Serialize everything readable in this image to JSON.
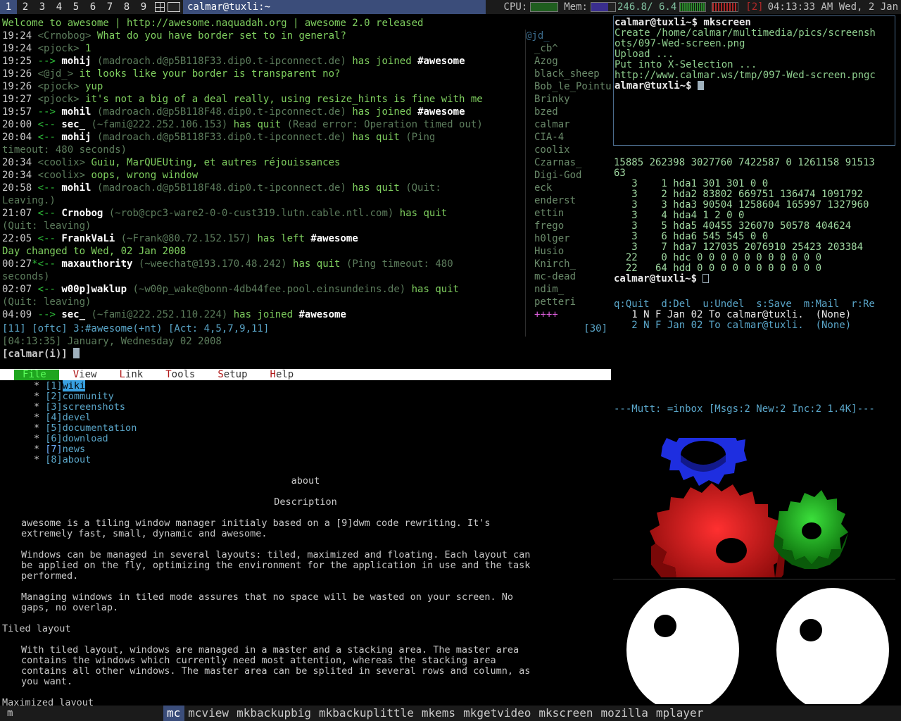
{
  "topbar": {
    "tags": [
      "1",
      "2",
      "3",
      "4",
      "5",
      "6",
      "7",
      "8",
      "9"
    ],
    "selected_tag": "1",
    "window_title": "calmar@tuxli:~",
    "cpu_label": "CPU:",
    "mem_label": "Mem:",
    "mem_value": "246.8/ 6.4",
    "clients": "[2]",
    "datetime": "04:13:33 AM Wed,  2 Jan"
  },
  "weechat": {
    "lines": [
      {
        "time": "Welcome to awesome | http://awesome.naquadah.org | awesome 2.0 released",
        "parts": []
      },
      {
        "time": "19:24",
        "parts": [
          {
            "c": "dim",
            "t": " <"
          },
          {
            "c": "dim",
            "t": "Crnobog"
          },
          {
            "c": "dim",
            "t": "> "
          },
          {
            "c": "lgreen",
            "t": "What do you have border set to in general?"
          }
        ]
      },
      {
        "time": "19:24",
        "parts": [
          {
            "c": "dim",
            "t": " <pjock> "
          },
          {
            "c": "lgreen",
            "t": "1"
          }
        ]
      },
      {
        "time": "19:25",
        "parts": [
          {
            "c": "green",
            "t": " --> "
          },
          {
            "c": "bold",
            "t": "mohij"
          },
          {
            "c": "dim",
            "t": " (madroach.d@p5B118F33.dip0.t-ipconnect.de) "
          },
          {
            "c": "lgreen",
            "t": "has joined "
          },
          {
            "c": "bold",
            "t": "#awesome"
          }
        ]
      },
      {
        "time": "19:26",
        "parts": [
          {
            "c": "dim",
            "t": " <@jd_> "
          },
          {
            "c": "lgreen",
            "t": "it looks like your border is transparent no?"
          }
        ]
      },
      {
        "time": "19:26",
        "parts": [
          {
            "c": "dim",
            "t": " <pjock> "
          },
          {
            "c": "lgreen",
            "t": "yup"
          }
        ]
      },
      {
        "time": "19:27",
        "parts": [
          {
            "c": "dim",
            "t": " <pjock> "
          },
          {
            "c": "lgreen",
            "t": "it's not a big of a deal really, using resize_hints is fine with me"
          }
        ]
      },
      {
        "time": "19:57",
        "parts": [
          {
            "c": "green",
            "t": " --> "
          },
          {
            "c": "bold",
            "t": "mohil"
          },
          {
            "c": "dim",
            "t": " (madroach.d@p5B118F48.dip0.t-ipconnect.de) "
          },
          {
            "c": "lgreen",
            "t": "has joined "
          },
          {
            "c": "bold",
            "t": "#awesome"
          }
        ]
      },
      {
        "time": "20:00",
        "parts": [
          {
            "c": "green",
            "t": " <-- "
          },
          {
            "c": "bold",
            "t": "sec_"
          },
          {
            "c": "dim",
            "t": " (~fami@222.252.106.153) "
          },
          {
            "c": "lgreen",
            "t": "has quit "
          },
          {
            "c": "dim",
            "t": "(Read error: Operation timed out)"
          }
        ]
      },
      {
        "time": "20:04",
        "parts": [
          {
            "c": "green",
            "t": " <-- "
          },
          {
            "c": "bold",
            "t": "mohij"
          },
          {
            "c": "dim",
            "t": " (madroach.d@p5B118F33.dip0.t-ipconnect.de) "
          },
          {
            "c": "lgreen",
            "t": "has quit "
          },
          {
            "c": "dim",
            "t": "(Ping"
          }
        ]
      },
      {
        "time": "",
        "parts": [
          {
            "c": "dim",
            "t": "          timeout: 480 seconds)"
          }
        ]
      },
      {
        "time": "20:34",
        "parts": [
          {
            "c": "dim",
            "t": " <coolix> "
          },
          {
            "c": "lgreen",
            "t": "Guiu, MarQUEUting, et autres réjouissances"
          }
        ]
      },
      {
        "time": "20:34",
        "parts": [
          {
            "c": "dim",
            "t": " <coolix> "
          },
          {
            "c": "lgreen",
            "t": "oops, wrong window"
          }
        ]
      },
      {
        "time": "20:58",
        "parts": [
          {
            "c": "green",
            "t": " <-- "
          },
          {
            "c": "bold",
            "t": "mohil"
          },
          {
            "c": "dim",
            "t": " (madroach.d@p5B118F48.dip0.t-ipconnect.de) "
          },
          {
            "c": "lgreen",
            "t": "has quit "
          },
          {
            "c": "dim",
            "t": "(Quit:"
          }
        ]
      },
      {
        "time": "",
        "parts": [
          {
            "c": "dim",
            "t": "          Leaving.)"
          }
        ]
      },
      {
        "time": "21:07",
        "parts": [
          {
            "c": "green",
            "t": " <-- "
          },
          {
            "c": "bold",
            "t": "Crnobog"
          },
          {
            "c": "dim",
            "t": " (~rob@cpc3-ware2-0-0-cust319.lutn.cable.ntl.com) "
          },
          {
            "c": "lgreen",
            "t": "has quit"
          }
        ]
      },
      {
        "time": "",
        "parts": [
          {
            "c": "dim",
            "t": "          (Quit: leaving)"
          }
        ]
      },
      {
        "time": "22:05",
        "parts": [
          {
            "c": "green",
            "t": " <-- "
          },
          {
            "c": "bold",
            "t": "FrankVaLi"
          },
          {
            "c": "dim",
            "t": " (~Frank@80.72.152.157) "
          },
          {
            "c": "lgreen",
            "t": "has left "
          },
          {
            "c": "bold",
            "t": "#awesome"
          }
        ]
      },
      {
        "time": "",
        "parts": [
          {
            "c": "lgreen",
            "t": " Day changed to Wed, 02 Jan 2008"
          }
        ]
      },
      {
        "time": "00:27",
        "parts": [
          {
            "c": "green",
            "t": "*<-- "
          },
          {
            "c": "bold",
            "t": "maxauthority"
          },
          {
            "c": "dim",
            "t": " (~weechat@193.170.48.242) "
          },
          {
            "c": "lgreen",
            "t": "has quit "
          },
          {
            "c": "dim",
            "t": "(Ping timeout: 480"
          }
        ]
      },
      {
        "time": "",
        "parts": [
          {
            "c": "dim",
            "t": "          seconds)"
          }
        ]
      },
      {
        "time": "02:07",
        "parts": [
          {
            "c": "green",
            "t": " <-- "
          },
          {
            "c": "bold",
            "t": "w00p]waklup"
          },
          {
            "c": "dim",
            "t": " (~w00p_wake@bonn-4db44fee.pool.einsundeins.de) "
          },
          {
            "c": "lgreen",
            "t": "has quit"
          }
        ]
      },
      {
        "time": "",
        "parts": [
          {
            "c": "dim",
            "t": "          (Quit: leaving)"
          }
        ]
      },
      {
        "time": "04:09",
        "parts": [
          {
            "c": "green",
            "t": " --> "
          },
          {
            "c": "bold",
            "t": "sec_"
          },
          {
            "c": "dim",
            "t": " (~fami@222.252.110.224) "
          },
          {
            "c": "lgreen",
            "t": "has joined "
          },
          {
            "c": "bold",
            "t": "#awesome"
          }
        ]
      }
    ],
    "nicklist": [
      "@jd_",
      "_cb^",
      "Azog",
      "black_sheep",
      "Bob_le_Pointu",
      "Brinky",
      "bzed",
      "calmar",
      "CIA-4",
      "coolix",
      "Czarnas_",
      "Digi-God",
      "eck",
      "enderst",
      "ettin",
      "frego",
      "h0lger",
      "Husio",
      "Knirch_",
      "mc-dead",
      "ndim_",
      "petteri",
      "++++"
    ],
    "status_left": "[11] [oftc] 3:#awesome(+nt) [Act: 4,5,7,9,11]",
    "status_right": "[30]",
    "date_line": "[04:13:35] January, Wednesday 02 2008",
    "input_prompt": "[calmar(i)]"
  },
  "elinks": {
    "menu": [
      "File",
      "View",
      "Link",
      "Tools",
      "Setup",
      "Help"
    ],
    "nav": [
      {
        "num": "[1]",
        "label": "wiki",
        "selected": true
      },
      {
        "num": "[2]",
        "label": "community",
        "selected": false
      },
      {
        "num": "[3]",
        "label": "screenshots",
        "selected": false
      },
      {
        "num": "[4]",
        "label": "devel",
        "selected": false
      },
      {
        "num": "[5]",
        "label": "documentation",
        "selected": false
      },
      {
        "num": "[6]",
        "label": "download",
        "selected": false
      },
      {
        "num": "[7]",
        "label": "news",
        "selected": false
      },
      {
        "num": "[8]",
        "label": "about",
        "selected": false
      }
    ],
    "heading_about": "about",
    "heading_description": "Description",
    "para1": "awesome is a tiling window manager initialy based on a [9]dwm code rewriting. It's\nextremely fast, small, dynamic and awesome.",
    "para2": "Windows can be managed in several layouts: tiled, maximized and floating. Each layout can\nbe applied on the fly, optimizing the environment for the application in use and the task\nperformed.",
    "para3": "Managing windows in tiled mode assures that no space will be wasted on your screen. No\ngaps, no overlap.",
    "h_tiled": "Tiled layout",
    "para4": "With tiled layout, windows are managed in a master and a stacking area. The master area\ncontains the windows which currently need most attention, whereas the stacking area\ncontains all other windows. The master area can be splited in several rows and column, as\nyou want.",
    "h_max": "Maximized layout"
  },
  "terminal": {
    "lines": [
      {
        "k": "p",
        "t": "calmar@tuxli~$ mkscreen"
      },
      {
        "k": "o",
        "t": "Create /home/calmar/multimedia/pics/screensh"
      },
      {
        "k": "o",
        "t": "ots/097-Wed-screen.png"
      },
      {
        "k": "o",
        "t": "Upload ..."
      },
      {
        "k": "o",
        "t": "Put into X-Selection ..."
      },
      {
        "k": "o",
        "t": "http://www.calmar.ws/tmp/097-Wed-screen.pngc"
      },
      {
        "k": "p",
        "t": "almar@tuxli~$ "
      }
    ]
  },
  "diskstats": {
    "lines": [
      "15885 262398 3027760 7422587 0 1261158 91513",
      "63",
      "   3    1 hda1 301 301 0 0",
      "   3    2 hda2 83802 669751 136474 1091792",
      "   3    3 hda3 90504 1258604 165997 1327960",
      "   3    4 hda4 1 2 0 0",
      "   3    5 hda5 40455 326070 50578 404624",
      "   3    6 hda6 545 545 0 0",
      "   3    7 hda7 127035 2076910 25423 203384",
      "  22    0 hdc 0 0 0 0 0 0 0 0 0 0 0",
      "  22   64 hdd 0 0 0 0 0 0 0 0 0 0 0"
    ],
    "prompt": "calmar@tuxli~$ "
  },
  "mutt": {
    "help": "q:Quit  d:Del  u:Undel  s:Save  m:Mail  r:Re",
    "messages": [
      "   1 N F Jan 02 To calmar@tuxli.  (None)",
      "   2 N F Jan 02 To calmar@tuxli.  (None)"
    ],
    "status": "---Mutt: =inbox [Msgs:2 New:2 Inc:2 1.4K]---"
  },
  "bottombar": {
    "prompt": "m",
    "items": [
      "mc",
      "mcview",
      "mkbackupbig",
      "mkbackuplittle",
      "mkems",
      "mkgetvideo",
      "mkscreen",
      "mozilla",
      "mplayer"
    ],
    "selected": "mc"
  },
  "colors": {
    "tag_selected": "#3b4d7a",
    "bar_bg": "#1b1b1b",
    "gear_red": "#c81414",
    "gear_green": "#14a014",
    "gear_blue": "#1e2ee0"
  }
}
